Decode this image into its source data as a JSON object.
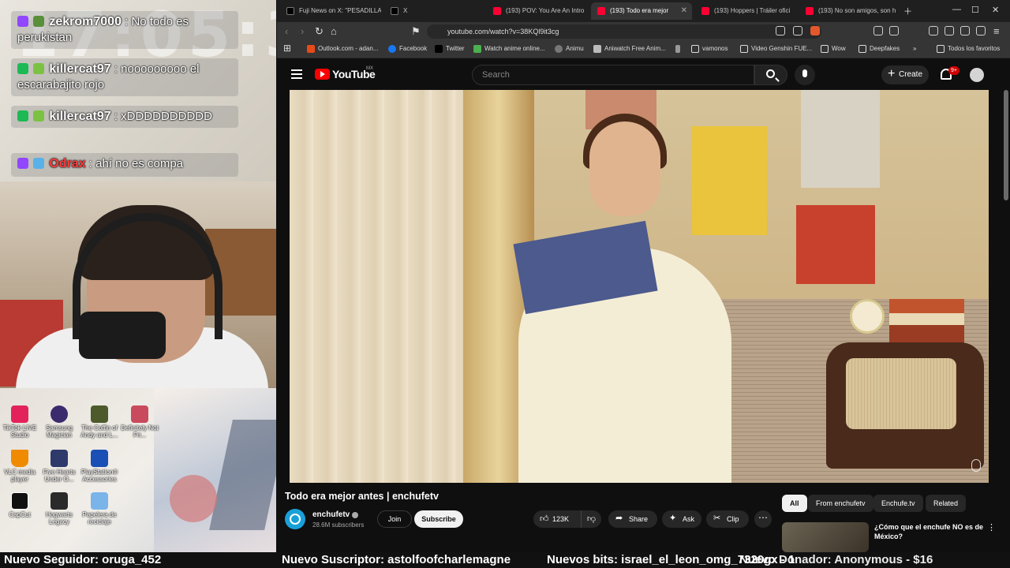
{
  "overlay": {
    "clock": "17:05:38",
    "chat": [
      {
        "user": "zekrom7000",
        "text": ": No todo es perukistan",
        "color": "#ffffff"
      },
      {
        "user": "killercat97",
        "text": ": nooooooooo el escarabajito rojo",
        "color": "#ffffff"
      },
      {
        "user": "killercat97",
        "text": ": xDDDDDDDDDD",
        "color": "#ffffff"
      },
      {
        "user": "Odrax",
        "text": ": ahí no es compa",
        "color": "#ff3a3a"
      }
    ],
    "desktop_icons": [
      {
        "label": "TikTok LIVE Studio",
        "color": "#e3225b"
      },
      {
        "label": "Samsung Magician",
        "color": "#3a2b6e"
      },
      {
        "label": "The Coffin of Andy and L...",
        "color": "#4d5a2b"
      },
      {
        "label": "Definitely Not Fri...",
        "color": "#c94a5c"
      },
      {
        "label": "VLC media player",
        "color": "#f08a00"
      },
      {
        "label": "Five Hearts Under O...",
        "color": "#2d3a6a"
      },
      {
        "label": "PlayStation® Accessories",
        "color": "#1a4fb5"
      },
      {
        "label": "CapCut",
        "color": "#111111"
      },
      {
        "label": "Hogwarts Legacy",
        "color": "#2a2a2a"
      },
      {
        "label": "Papelera de reciclaje",
        "color": "#7ab4e8"
      }
    ]
  },
  "browser": {
    "tabs": [
      {
        "label": "Fuji News on X: \"PESADILLA",
        "icon": "x-icon"
      },
      {
        "label": "X",
        "icon": "x-icon"
      },
      {
        "label": "(193) POV: You Are An Intro",
        "icon": "youtube-icon"
      },
      {
        "label": "(193) Todo era mejor",
        "icon": "youtube-icon",
        "active": true
      },
      {
        "label": "(193) Hoppers | Tráiler ofici",
        "icon": "youtube-icon"
      },
      {
        "label": "(193) No son amigos, son h",
        "icon": "youtube-icon"
      }
    ],
    "url": "youtube.com/watch?v=38KQl9it3cg",
    "bookmarks": [
      "Outlook.com - adan...",
      "Facebook",
      "Twitter",
      "Watch anime online...",
      "Animu",
      "Aniwatch Free Anim...",
      "vamonos",
      "Video Genshin FUE...",
      "Wow",
      "Deepfakes",
      "Todos los favoritos"
    ]
  },
  "youtube": {
    "logo": "YouTube",
    "country": "MX",
    "search_placeholder": "Search",
    "create_label": "Create",
    "notif_badge": "9+",
    "video_title": "Todo era mejor antes | enchufetv",
    "channel_name": "enchufetv",
    "subscribers": "28.6M subscribers",
    "join_label": "Join",
    "subscribe_label": "Subscribe",
    "likes": "123K",
    "share_label": "Share",
    "ask_label": "Ask",
    "clip_label": "Clip",
    "chips": [
      "All",
      "From enchufetv",
      "Enchufe.tv",
      "Related"
    ],
    "rec_title": "¿Cómo que el enchufe NO es de México?"
  },
  "ticker": {
    "follower": "Nuevo Seguidor: oruga_452",
    "subscriber": "Nuevo Suscriptor: astolfoofcharlemagne",
    "bits": "Nuevos bits: israel_el_leon_omg_7320gx - 1",
    "donor": "Nuevo Donador: Anonymous - $16"
  }
}
